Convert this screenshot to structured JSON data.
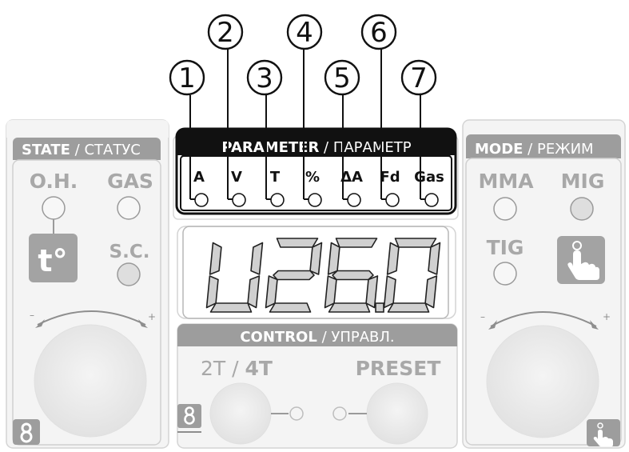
{
  "callouts": [
    "1",
    "2",
    "3",
    "4",
    "5",
    "6",
    "7"
  ],
  "state_panel": {
    "title_bold": "STATE",
    "title_rest": " / СТАТУС",
    "oh_label": "O.H.",
    "gas_label": "GAS",
    "temp_icon_text": "t°",
    "sc_label": "S.C.",
    "knob_minus": "–",
    "knob_plus": "+",
    "bottom_icon": "eight-shaped-icon"
  },
  "parameter_panel": {
    "title_bold": "PARAMETER",
    "title_rest": " / ПАРАМЕТР",
    "items": [
      "A",
      "V",
      "T",
      "%",
      "ΔA",
      "Fd",
      "Gas"
    ]
  },
  "display": {
    "value": "U26.0"
  },
  "control_panel": {
    "title_bold": "CONTROL",
    "title_rest": " / УПРАВЛ.",
    "left_label_prefix": "2T / ",
    "left_label_bold": "4T",
    "right_label": "PRESET",
    "left_icon": "eight-shaped-icon"
  },
  "mode_panel": {
    "title_bold": "MODE",
    "title_rest": " / РЕЖИМ",
    "mma_label": "MMA",
    "mig_label": "MIG",
    "tig_label": "TIG",
    "knob_minus": "–",
    "knob_plus": "+",
    "button_icon": "hand-pointer-icon",
    "bottom_icon": "hand-pointer-icon"
  },
  "colors": {
    "panel_bg": "#f5f5f5",
    "panel_header": "#9d9d9d",
    "label_gray": "#a8a8a8",
    "dark": "#111111",
    "segment_fill": "#d0d0d0"
  }
}
